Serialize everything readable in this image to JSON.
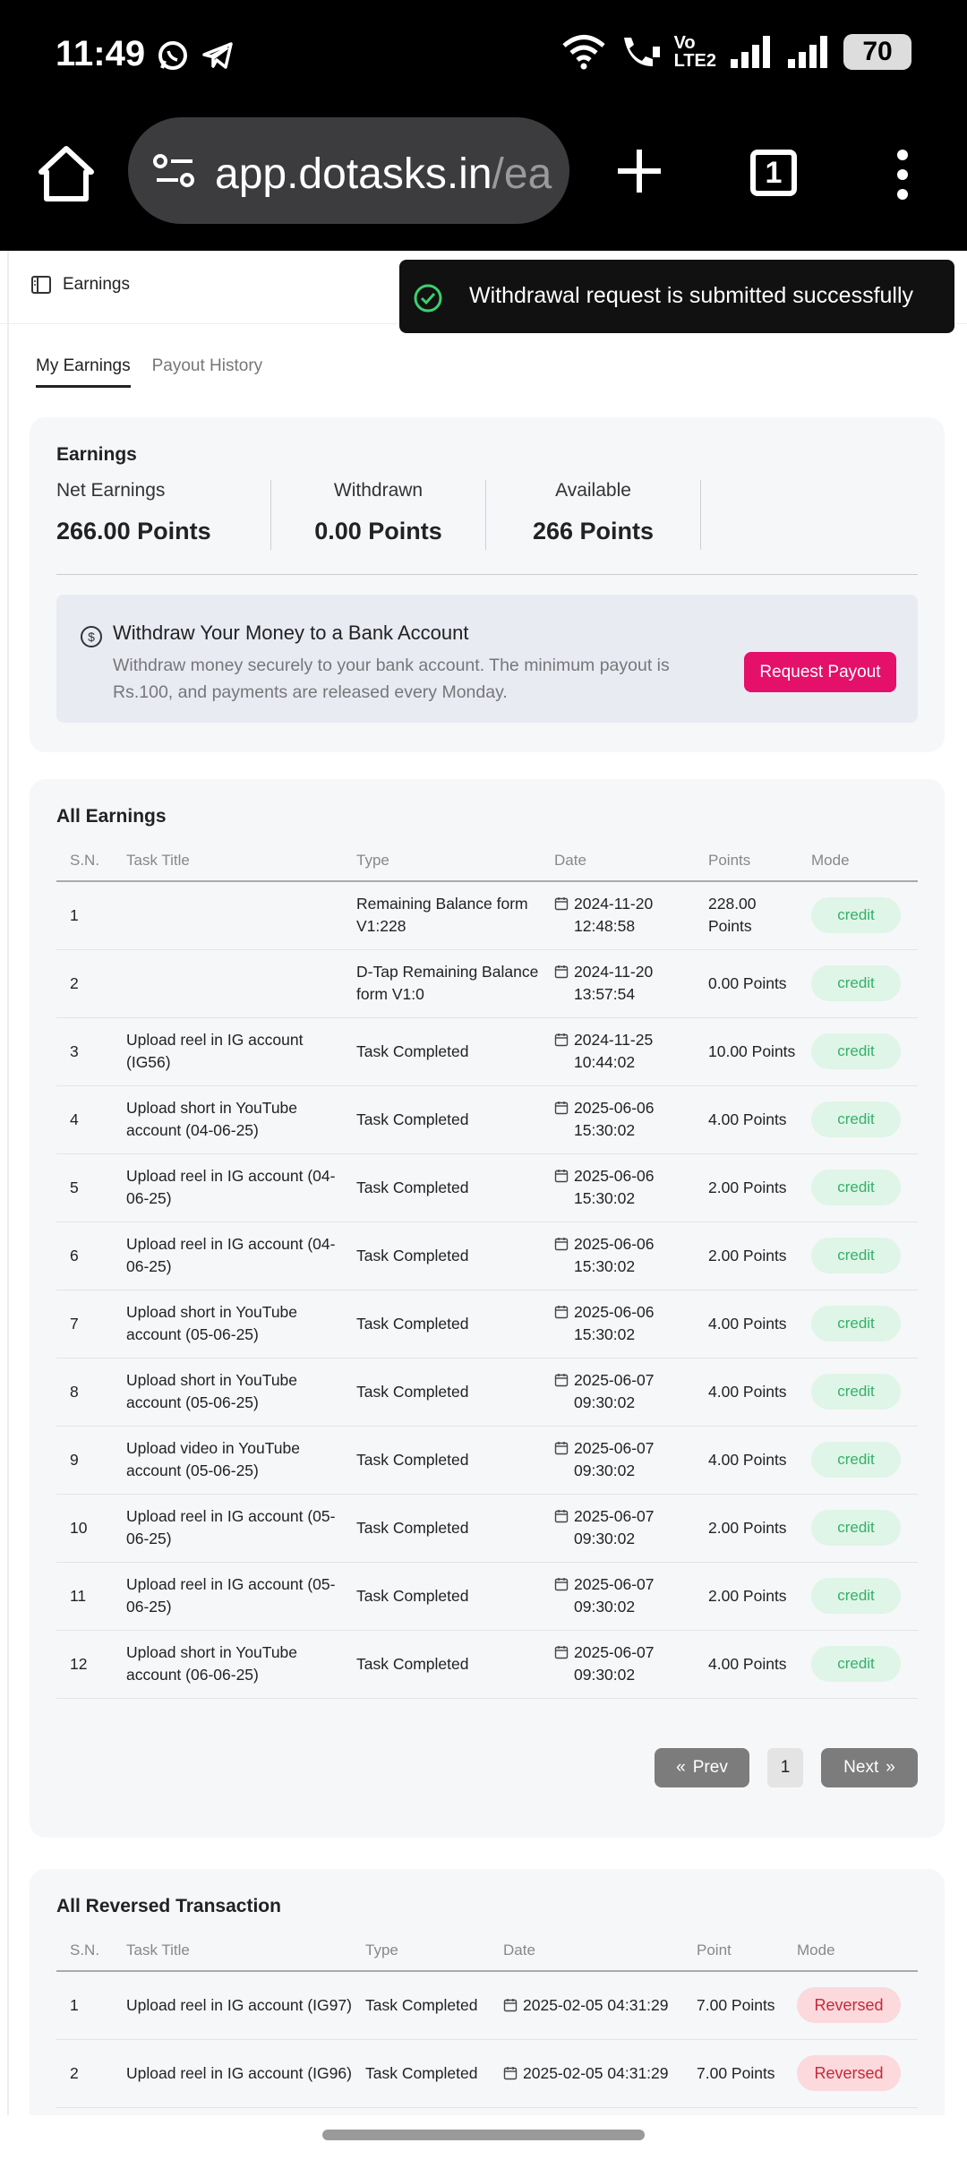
{
  "status": {
    "time": "11:49",
    "battery": "70",
    "network": "Vo LTE2"
  },
  "browser": {
    "url_main": "app.dotasks.in",
    "url_faded": "/ea",
    "tab_count": "1"
  },
  "nav": {
    "title": "Earnings"
  },
  "toast": {
    "message": "Withdrawal request is submitted successfully"
  },
  "tabs": [
    {
      "label": "My Earnings"
    },
    {
      "label": "Payout History"
    }
  ],
  "earnings": {
    "title": "Earnings",
    "stats": [
      {
        "label": "Net Earnings",
        "value": "266.00 Points"
      },
      {
        "label": "Withdrawn",
        "value": "0.00 Points"
      },
      {
        "label": "Available",
        "value": "266 Points"
      }
    ],
    "payout": {
      "title": "Withdraw Your Money to a Bank Account",
      "desc": "Withdraw money securely to your bank account. The minimum payout is Rs.100, and payments are released every Monday.",
      "button": "Request Payout"
    }
  },
  "all_earnings": {
    "title": "All Earnings",
    "headers": [
      "S.N.",
      "Task Title",
      "Type",
      "Date",
      "Points",
      "Mode"
    ],
    "rows": [
      {
        "sn": "1",
        "title": "",
        "type": "Remaining Balance form V1:228",
        "date": "2024-11-20 12:48:58",
        "points": "228.00 Points",
        "mode": "credit"
      },
      {
        "sn": "2",
        "title": "",
        "type": "D-Tap Remaining Balance form V1:0",
        "date": "2024-11-20 13:57:54",
        "points": "0.00 Points",
        "mode": "credit"
      },
      {
        "sn": "3",
        "title": "Upload reel in IG account (IG56)",
        "type": "Task Completed",
        "date": "2024-11-25 10:44:02",
        "points": "10.00 Points",
        "mode": "credit"
      },
      {
        "sn": "4",
        "title": "Upload short in YouTube account (04-06-25)",
        "type": "Task Completed",
        "date": "2025-06-06 15:30:02",
        "points": "4.00 Points",
        "mode": "credit"
      },
      {
        "sn": "5",
        "title": "Upload reel in IG account (04-06-25)",
        "type": "Task Completed",
        "date": "2025-06-06 15:30:02",
        "points": "2.00 Points",
        "mode": "credit"
      },
      {
        "sn": "6",
        "title": "Upload reel in IG account (04-06-25)",
        "type": "Task Completed",
        "date": "2025-06-06 15:30:02",
        "points": "2.00 Points",
        "mode": "credit"
      },
      {
        "sn": "7",
        "title": "Upload short in YouTube account (05-06-25)",
        "type": "Task Completed",
        "date": "2025-06-06 15:30:02",
        "points": "4.00 Points",
        "mode": "credit"
      },
      {
        "sn": "8",
        "title": "Upload short in YouTube account (05-06-25)",
        "type": "Task Completed",
        "date": "2025-06-07 09:30:02",
        "points": "4.00 Points",
        "mode": "credit"
      },
      {
        "sn": "9",
        "title": "Upload video in YouTube account (05-06-25)",
        "type": "Task Completed",
        "date": "2025-06-07 09:30:02",
        "points": "4.00 Points",
        "mode": "credit"
      },
      {
        "sn": "10",
        "title": "Upload reel in IG account (05-06-25)",
        "type": "Task Completed",
        "date": "2025-06-07 09:30:02",
        "points": "2.00 Points",
        "mode": "credit"
      },
      {
        "sn": "11",
        "title": "Upload reel in IG account (05-06-25)",
        "type": "Task Completed",
        "date": "2025-06-07 09:30:02",
        "points": "2.00 Points",
        "mode": "credit"
      },
      {
        "sn": "12",
        "title": "Upload short in YouTube account (06-06-25)",
        "type": "Task Completed",
        "date": "2025-06-07 09:30:02",
        "points": "4.00 Points",
        "mode": "credit"
      }
    ],
    "pager": {
      "prev": "Prev",
      "page": "1",
      "next": "Next"
    }
  },
  "reversed": {
    "title": "All Reversed Transaction",
    "headers": [
      "S.N.",
      "Task Title",
      "Type",
      "Date",
      "Point",
      "Mode"
    ],
    "rows": [
      {
        "sn": "1",
        "title": "Upload reel in IG account (IG97)",
        "type": "Task Completed",
        "date": "2025-02-05 04:31:29",
        "points": "7.00 Points",
        "mode": "Reversed"
      },
      {
        "sn": "2",
        "title": "Upload reel in IG account (IG96)",
        "type": "Task Completed",
        "date": "2025-02-05 04:31:29",
        "points": "7.00 Points",
        "mode": "Reversed"
      }
    ]
  },
  "colors": {
    "accent": "#e4106a",
    "credit_bg": "#dff5e7",
    "credit_fg": "#35b06a",
    "reversed_bg": "#fbd9dc",
    "reversed_fg": "#c8283a"
  }
}
